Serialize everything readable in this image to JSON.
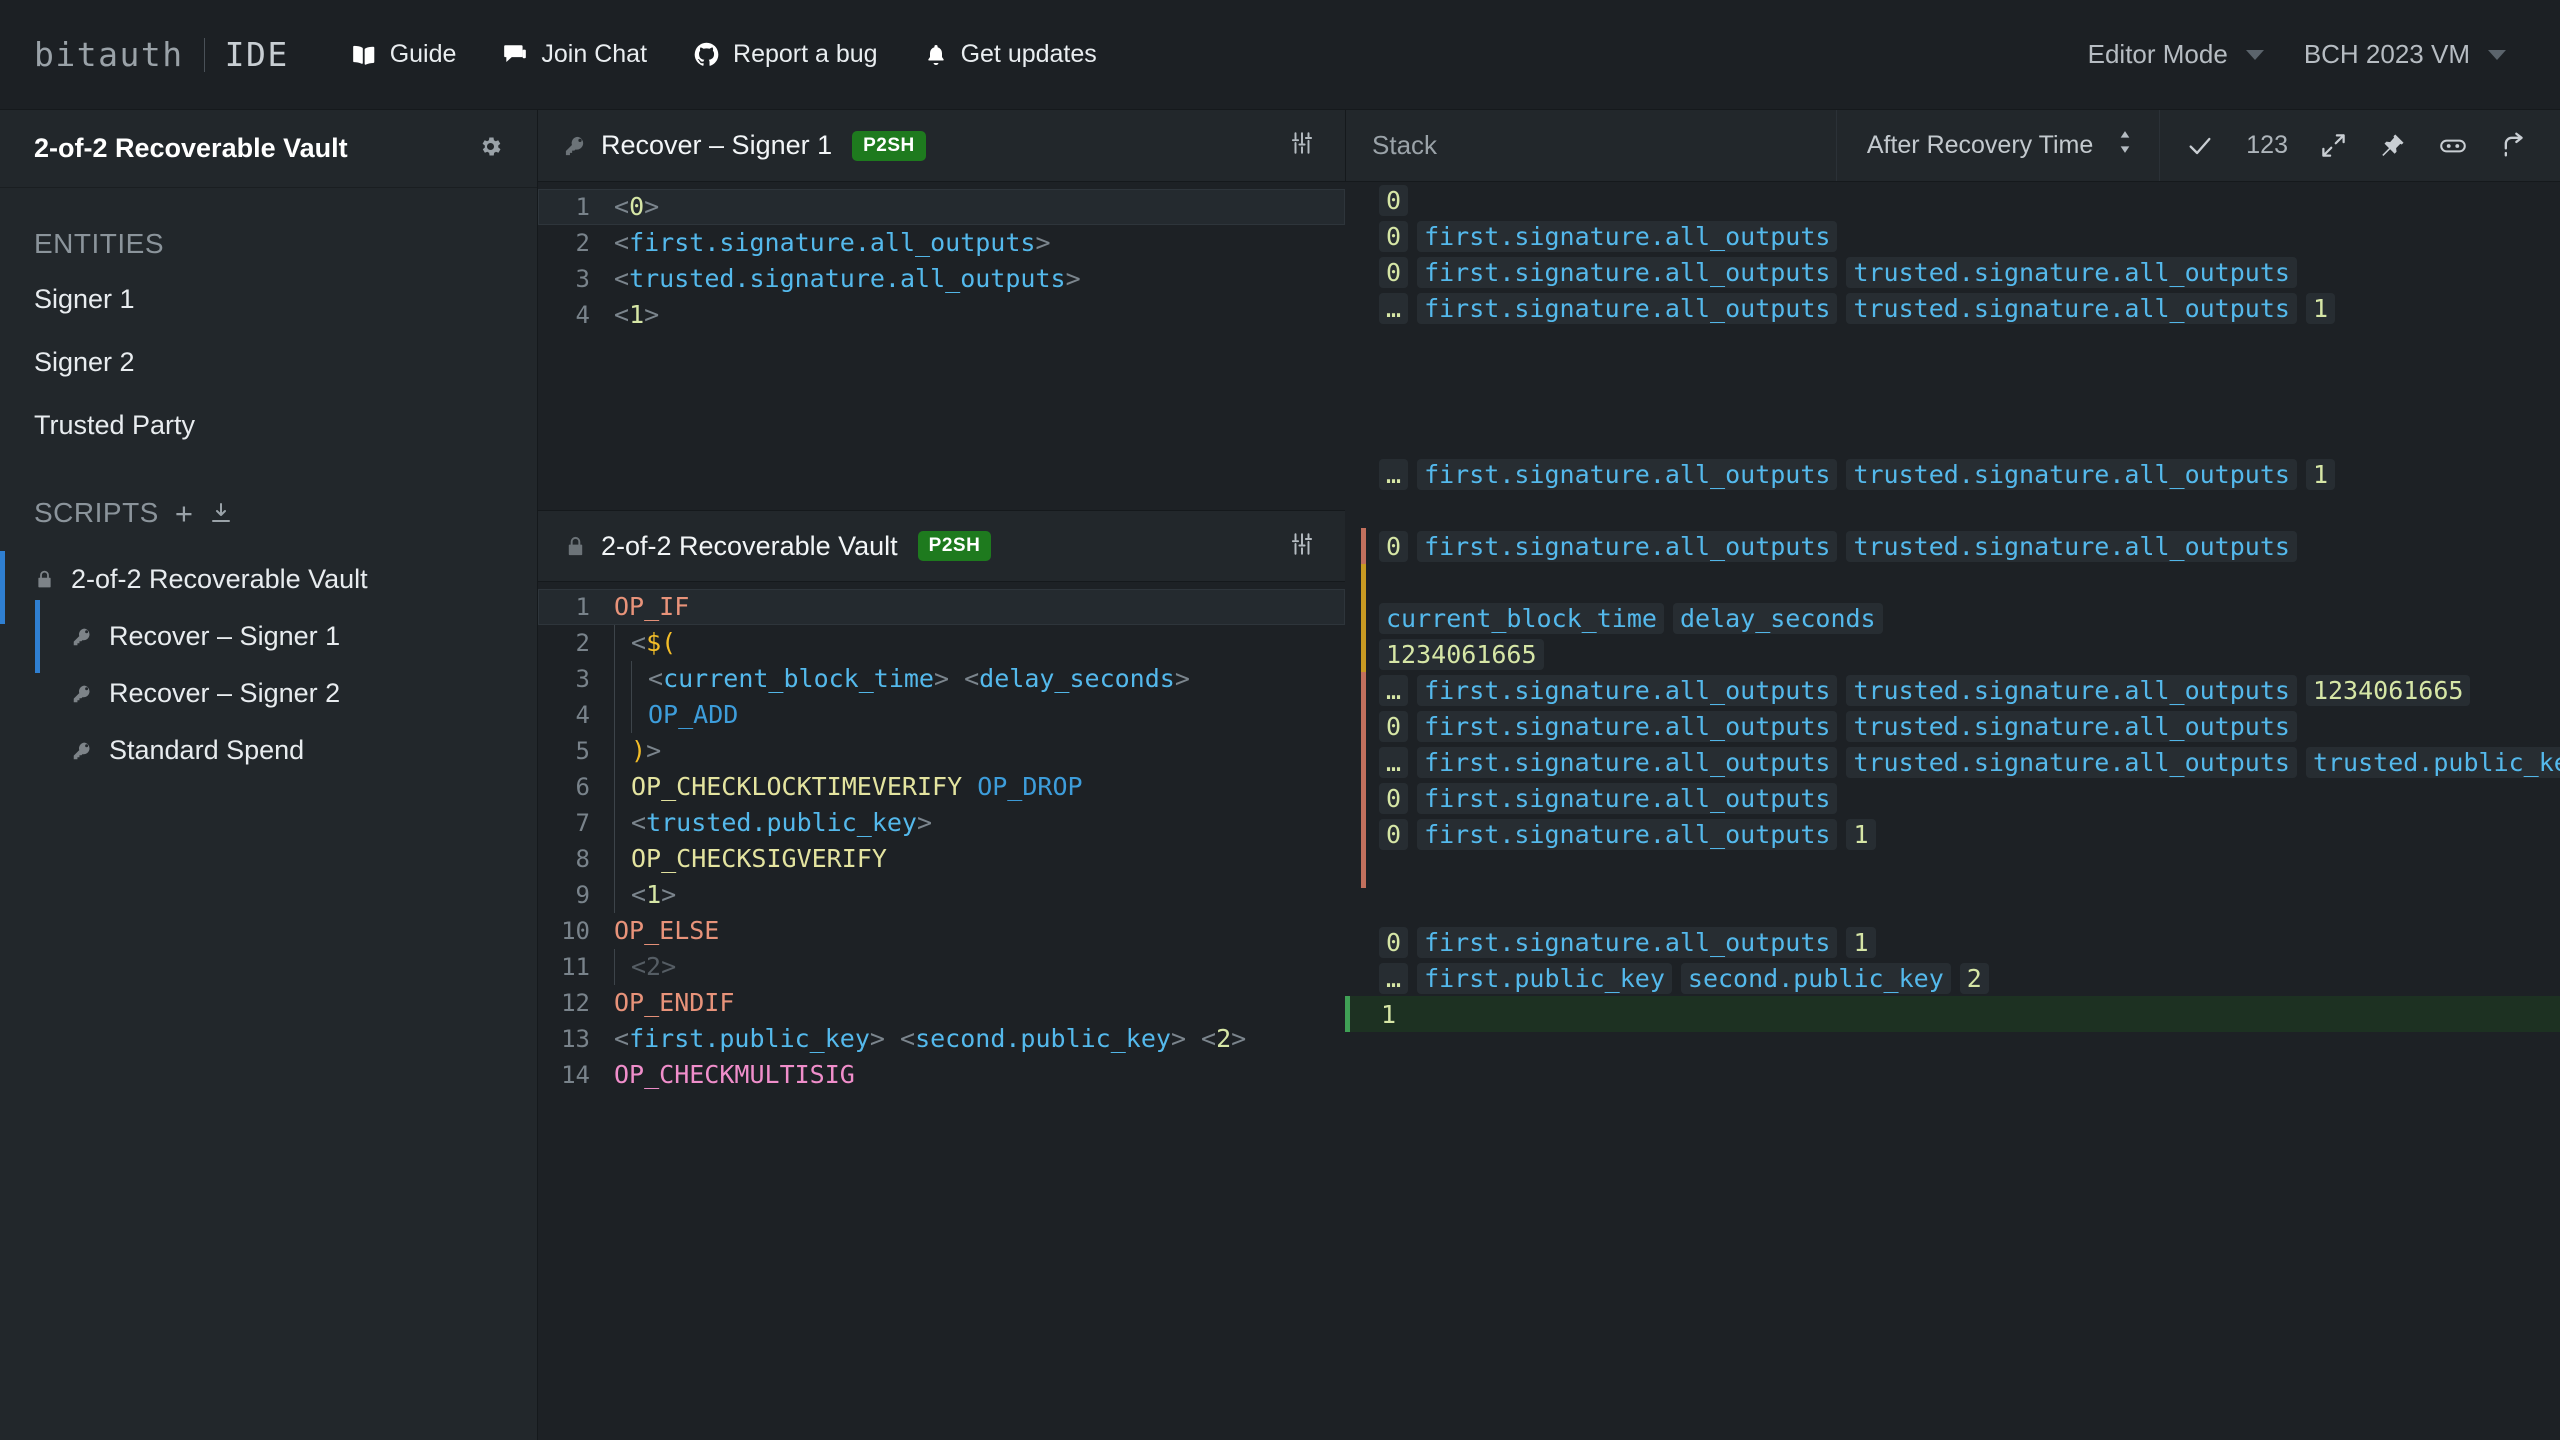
{
  "header": {
    "brand_name": "bitauth",
    "brand_product": "IDE",
    "links": [
      {
        "label": "Guide",
        "icon": "book-icon"
      },
      {
        "label": "Join Chat",
        "icon": "chat-icon"
      },
      {
        "label": "Report a bug",
        "icon": "github-icon"
      },
      {
        "label": "Get updates",
        "icon": "bell-icon"
      }
    ],
    "editor_mode": "Editor Mode",
    "vm": "BCH 2023 VM"
  },
  "sidebar": {
    "project_title": "2-of-2 Recoverable Vault",
    "settings_icon": "gear-icon",
    "entities_label": "ENTITIES",
    "entities": [
      {
        "label": "Signer 1"
      },
      {
        "label": "Signer 2"
      },
      {
        "label": "Trusted Party"
      }
    ],
    "scripts_label": "SCRIPTS",
    "add_icon": "plus-icon",
    "import_icon": "download-icon",
    "scripts": [
      {
        "label": "2-of-2 Recoverable Vault",
        "icon": "lock-icon",
        "level": 0,
        "active": true
      },
      {
        "label": "Recover – Signer 1",
        "icon": "key-icon",
        "level": 1,
        "active": true
      },
      {
        "label": "Recover – Signer 2",
        "icon": "key-icon",
        "level": 1,
        "active": false
      },
      {
        "label": "Standard Spend",
        "icon": "key-icon",
        "level": 1,
        "active": false
      }
    ]
  },
  "editors": [
    {
      "title": "Recover – Signer 1",
      "icon": "key-icon",
      "badge": "P2SH",
      "tools_icon": "sliders-icon",
      "lines": [
        {
          "n": "1",
          "highlight": true,
          "indent": 0,
          "tokens": [
            {
              "t": "<",
              "c": "t-br"
            },
            {
              "t": "0",
              "c": "t-num"
            },
            {
              "t": ">",
              "c": "t-br"
            }
          ]
        },
        {
          "n": "2",
          "highlight": false,
          "indent": 0,
          "tokens": [
            {
              "t": "<",
              "c": "t-br"
            },
            {
              "t": "first.signature.all_outputs",
              "c": "t-var"
            },
            {
              "t": ">",
              "c": "t-br"
            }
          ]
        },
        {
          "n": "3",
          "highlight": false,
          "indent": 0,
          "tokens": [
            {
              "t": "<",
              "c": "t-br"
            },
            {
              "t": "trusted.signature.all_outputs",
              "c": "t-var"
            },
            {
              "t": ">",
              "c": "t-br"
            }
          ]
        },
        {
          "n": "4",
          "highlight": false,
          "indent": 0,
          "tokens": [
            {
              "t": "<",
              "c": "t-br"
            },
            {
              "t": "1",
              "c": "t-num"
            },
            {
              "t": ">",
              "c": "t-br"
            }
          ]
        }
      ]
    },
    {
      "title": "2-of-2 Recoverable Vault",
      "icon": "lock-icon",
      "badge": "P2SH",
      "tools_icon": "sliders-icon",
      "lines": [
        {
          "n": "1",
          "highlight": true,
          "indent": 0,
          "tokens": [
            {
              "t": "OP_IF",
              "c": "t-op-ctl"
            }
          ]
        },
        {
          "n": "2",
          "highlight": false,
          "indent": 1,
          "tokens": [
            {
              "t": "<",
              "c": "t-br"
            },
            {
              "t": "$(",
              "c": "t-dollar"
            }
          ]
        },
        {
          "n": "3",
          "highlight": false,
          "indent": 2,
          "tokens": [
            {
              "t": "<",
              "c": "t-br"
            },
            {
              "t": "current_block_time",
              "c": "t-var"
            },
            {
              "t": "> ",
              "c": "t-br"
            },
            {
              "t": "<",
              "c": "t-br"
            },
            {
              "t": "delay_seconds",
              "c": "t-var"
            },
            {
              "t": ">",
              "c": "t-br"
            }
          ]
        },
        {
          "n": "4",
          "highlight": false,
          "indent": 2,
          "tokens": [
            {
              "t": "OP_ADD",
              "c": "t-op-b"
            }
          ]
        },
        {
          "n": "5",
          "highlight": false,
          "indent": 1,
          "tokens": [
            {
              "t": ")",
              "c": "t-dollar"
            },
            {
              "t": ">",
              "c": "t-br"
            }
          ]
        },
        {
          "n": "6",
          "highlight": false,
          "indent": 1,
          "tokens": [
            {
              "t": "OP_CHECKLOCKTIMEVERIFY ",
              "c": "t-op-y"
            },
            {
              "t": "OP_DROP",
              "c": "t-op-b"
            }
          ]
        },
        {
          "n": "7",
          "highlight": false,
          "indent": 1,
          "tokens": [
            {
              "t": "<",
              "c": "t-br"
            },
            {
              "t": "trusted.public_key",
              "c": "t-var"
            },
            {
              "t": ">",
              "c": "t-br"
            }
          ]
        },
        {
          "n": "8",
          "highlight": false,
          "indent": 1,
          "tokens": [
            {
              "t": "OP_CHECKSIGVERIFY",
              "c": "t-op-y"
            }
          ]
        },
        {
          "n": "9",
          "highlight": false,
          "indent": 1,
          "tokens": [
            {
              "t": "<",
              "c": "t-br"
            },
            {
              "t": "1",
              "c": "t-num"
            },
            {
              "t": ">",
              "c": "t-br"
            }
          ]
        },
        {
          "n": "10",
          "highlight": false,
          "indent": 0,
          "tokens": [
            {
              "t": "OP_ELSE",
              "c": "t-op-ctl"
            }
          ]
        },
        {
          "n": "11",
          "highlight": false,
          "indent": 1,
          "tokens": [
            {
              "t": "<2>",
              "c": "t-dim"
            }
          ]
        },
        {
          "n": "12",
          "highlight": false,
          "indent": 0,
          "tokens": [
            {
              "t": "OP_ENDIF",
              "c": "t-op-ctl"
            }
          ]
        },
        {
          "n": "13",
          "highlight": false,
          "indent": 0,
          "tokens": [
            {
              "t": "<",
              "c": "t-br"
            },
            {
              "t": "first.public_key",
              "c": "t-var"
            },
            {
              "t": "> ",
              "c": "t-br"
            },
            {
              "t": "<",
              "c": "t-br"
            },
            {
              "t": "second.public_key",
              "c": "t-var"
            },
            {
              "t": "> ",
              "c": "t-br"
            },
            {
              "t": "<",
              "c": "t-br"
            },
            {
              "t": "2",
              "c": "t-num"
            },
            {
              "t": ">",
              "c": "t-br"
            }
          ]
        },
        {
          "n": "14",
          "highlight": false,
          "indent": 0,
          "tokens": [
            {
              "t": "OP_CHECKMULTISIG",
              "c": "t-op-m"
            }
          ]
        }
      ]
    }
  ],
  "stack": {
    "title": "Stack",
    "scenario": "After Recovery Time",
    "scenario_icon": "sort-updown-icon",
    "icons": [
      {
        "name": "check-icon",
        "glyph": "check"
      },
      {
        "name": "number-format-icon",
        "glyph": "123",
        "text": "123"
      },
      {
        "name": "expand-icon",
        "glyph": "expand"
      },
      {
        "name": "pin-icon",
        "glyph": "pin"
      },
      {
        "name": "eye-icon",
        "glyph": "eye"
      },
      {
        "name": "redo-icon",
        "glyph": "redo"
      }
    ],
    "top_rows": [
      {
        "nest": "none",
        "items": [
          {
            "v": "0",
            "k": "num"
          }
        ]
      },
      {
        "nest": "none",
        "items": [
          {
            "v": "0",
            "k": "num"
          },
          {
            "v": "first.signature.all_outputs",
            "k": "var"
          }
        ]
      },
      {
        "nest": "none",
        "items": [
          {
            "v": "0",
            "k": "num"
          },
          {
            "v": "first.signature.all_outputs",
            "k": "var"
          },
          {
            "v": "trusted.signature.all_outputs",
            "k": "var"
          }
        ]
      },
      {
        "nest": "none",
        "items": [
          {
            "v": "…",
            "k": "num"
          },
          {
            "v": "first.signature.all_outputs",
            "k": "var"
          },
          {
            "v": "trusted.signature.all_outputs",
            "k": "var"
          },
          {
            "v": "1",
            "k": "num"
          }
        ]
      }
    ],
    "bottom_rows": [
      {
        "nest": "none",
        "gap": false,
        "items": [
          {
            "v": "…",
            "k": "num"
          },
          {
            "v": "first.signature.all_outputs",
            "k": "var"
          },
          {
            "v": "trusted.signature.all_outputs",
            "k": "var"
          },
          {
            "v": "1",
            "k": "num"
          }
        ]
      },
      {
        "nest": "none",
        "gap": true,
        "items": []
      },
      {
        "nest": "salmon",
        "gap": false,
        "items": [
          {
            "v": "0",
            "k": "num"
          },
          {
            "v": "first.signature.all_outputs",
            "k": "var"
          },
          {
            "v": "trusted.signature.all_outputs",
            "k": "var"
          }
        ]
      },
      {
        "nest": "gold",
        "gap": true,
        "items": []
      },
      {
        "nest": "gold",
        "gap": false,
        "items": [
          {
            "v": "current_block_time",
            "k": "var"
          },
          {
            "v": "delay_seconds",
            "k": "var"
          }
        ]
      },
      {
        "nest": "gold",
        "gap": false,
        "items": [
          {
            "v": "1234061665",
            "k": "num"
          }
        ]
      },
      {
        "nest": "salmon",
        "gap": false,
        "items": [
          {
            "v": "…",
            "k": "num"
          },
          {
            "v": "first.signature.all_outputs",
            "k": "var"
          },
          {
            "v": "trusted.signature.all_outputs",
            "k": "var"
          },
          {
            "v": "1234061665",
            "k": "num"
          }
        ]
      },
      {
        "nest": "salmon",
        "gap": false,
        "items": [
          {
            "v": "0",
            "k": "num"
          },
          {
            "v": "first.signature.all_outputs",
            "k": "var"
          },
          {
            "v": "trusted.signature.all_outputs",
            "k": "var"
          }
        ]
      },
      {
        "nest": "salmon",
        "gap": false,
        "items": [
          {
            "v": "…",
            "k": "num"
          },
          {
            "v": "first.signature.all_outputs",
            "k": "var"
          },
          {
            "v": "trusted.signature.all_outputs",
            "k": "var"
          },
          {
            "v": "trusted.public_key",
            "k": "var"
          }
        ]
      },
      {
        "nest": "salmon",
        "gap": false,
        "items": [
          {
            "v": "0",
            "k": "num"
          },
          {
            "v": "first.signature.all_outputs",
            "k": "var"
          }
        ]
      },
      {
        "nest": "salmon",
        "gap": false,
        "items": [
          {
            "v": "0",
            "k": "num"
          },
          {
            "v": "first.signature.all_outputs",
            "k": "var"
          },
          {
            "v": "1",
            "k": "num"
          }
        ]
      },
      {
        "nest": "salmon",
        "gap": true,
        "items": []
      },
      {
        "nest": "none",
        "gap": true,
        "items": []
      },
      {
        "nest": "none",
        "gap": false,
        "items": [
          {
            "v": "0",
            "k": "num"
          },
          {
            "v": "first.signature.all_outputs",
            "k": "var"
          },
          {
            "v": "1",
            "k": "num"
          }
        ]
      },
      {
        "nest": "none",
        "gap": false,
        "items": [
          {
            "v": "…",
            "k": "num"
          },
          {
            "v": "first.public_key",
            "k": "var"
          },
          {
            "v": "second.public_key",
            "k": "var"
          },
          {
            "v": "2",
            "k": "num"
          }
        ]
      },
      {
        "nest": "none",
        "gap": false,
        "success": true,
        "items": [
          {
            "v": "1",
            "k": "num",
            "bare": true
          }
        ]
      }
    ]
  },
  "colors": {
    "accent_blue": "#2f7fd1",
    "badge_green": "#1e7a1e",
    "success_bg": "#1d3122",
    "success_bar": "#3fa055",
    "nest_salmon": "#c2705d",
    "nest_gold": "#c99a22"
  }
}
